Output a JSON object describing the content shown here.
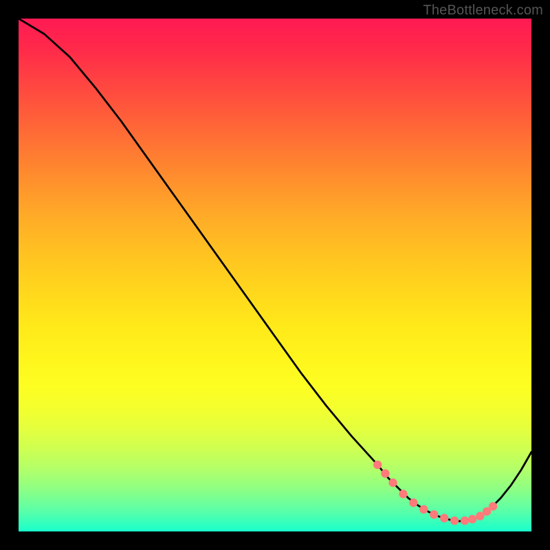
{
  "watermark": "TheBottleneck.com",
  "chart_data": {
    "type": "line",
    "title": "",
    "xlabel": "",
    "ylabel": "",
    "xlim": [
      0,
      100
    ],
    "ylim": [
      0,
      100
    ],
    "grid": false,
    "legend": false,
    "series": [
      {
        "name": "curve",
        "x": [
          0,
          5,
          10,
          15,
          20,
          25,
          30,
          35,
          40,
          45,
          50,
          55,
          60,
          65,
          70,
          72,
          74,
          76,
          78,
          80,
          82,
          84,
          86,
          88,
          90,
          92,
          94,
          96,
          98,
          100
        ],
        "y": [
          100,
          97,
          92.5,
          86.5,
          80,
          73,
          66,
          59,
          52,
          45,
          38,
          31,
          24.5,
          18.5,
          13,
          10.5,
          8.5,
          6.5,
          5,
          3.8,
          2.9,
          2.3,
          2,
          2.2,
          3,
          4.5,
          6.5,
          9,
          12,
          15.5
        ]
      }
    ],
    "marker_points": {
      "name": "highlighted-points",
      "x": [
        70,
        71.5,
        73,
        75,
        77,
        79,
        81,
        83,
        85,
        87,
        88.5,
        90,
        91.3,
        92.5
      ],
      "y": [
        13,
        11.3,
        9.5,
        7.3,
        5.6,
        4.3,
        3.3,
        2.6,
        2.1,
        2.1,
        2.4,
        3,
        3.9,
        4.9
      ]
    },
    "colors": {
      "gradient_top": "#ff1a53",
      "gradient_mid": "#ffe91a",
      "gradient_bottom": "#19ffcc",
      "curve_stroke": "#000000",
      "marker_fill": "#ff7a7a"
    }
  }
}
